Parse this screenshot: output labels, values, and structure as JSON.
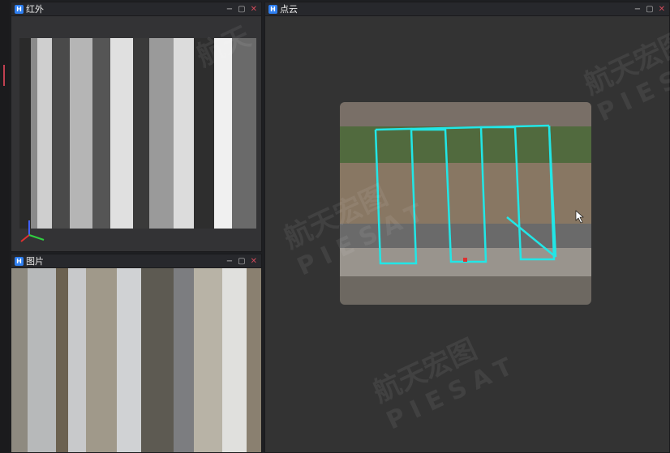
{
  "panels": {
    "infrared": {
      "title": "红外",
      "icon": "app-logo-icon"
    },
    "photo": {
      "title": "图片",
      "icon": "app-logo-icon"
    },
    "pointcloud": {
      "title": "点云",
      "icon": "app-logo-icon"
    }
  },
  "window_controls": {
    "minimize": "−",
    "maximize": "▢",
    "close": "✕"
  },
  "app_icon_glyph": "H",
  "watermark": {
    "cn": "航天宏图",
    "en": "PIESAT"
  },
  "colors": {
    "accent": "#2f7ff0",
    "flight_path": "#22e6e6",
    "close": "#d04a5a"
  }
}
